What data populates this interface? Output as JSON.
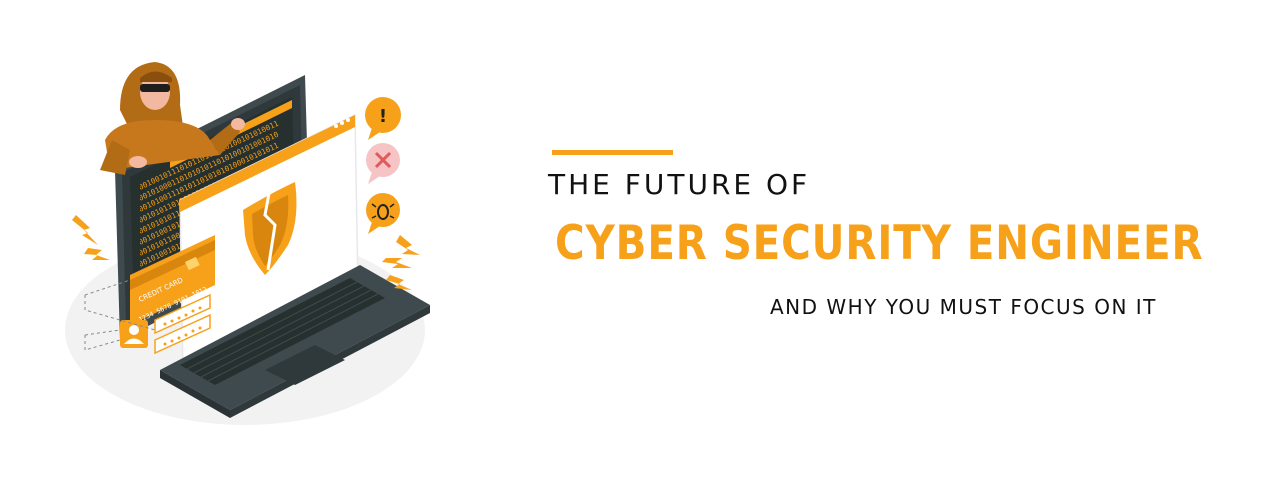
{
  "banner": {
    "heading_top": "THE FUTURE OF",
    "heading_main": "CYBER SECURITY ENGINEER",
    "heading_sub": "AND WHY YOU MUST FOCUS ON IT",
    "accent_color": "#f7a11a",
    "text_color": "#111111"
  },
  "illustration": {
    "card_label": "CREDIT CARD",
    "card_number": "1234 5678 9101 1012",
    "binary_rows": [
      "0010010111010110101010100101010011",
      "0010100011010101011010100101001010",
      "0010100111010110101010100010101011",
      "0010101101101011011011101010111001",
      "0010101011010110110101010101001010",
      "0010100101011010110101011010101001",
      "0010101100010010101010001010101001",
      "0010100101010010101011010101101010"
    ],
    "icons": [
      "hacker-figure",
      "monitor-icon",
      "laptop-icon",
      "shield-icon",
      "warning-icon",
      "error-icon",
      "bug-icon",
      "user-icon",
      "lightning-icon"
    ]
  }
}
